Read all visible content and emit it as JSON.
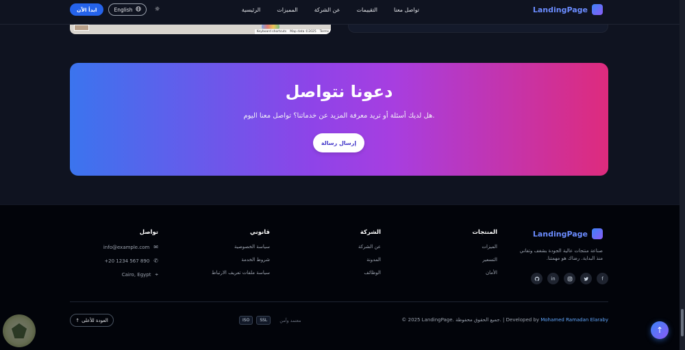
{
  "header": {
    "brand": "LandingPage",
    "nav": [
      "الرئيسية",
      "المميزات",
      "عن الشركة",
      "التقييمات",
      "تواصل معنا"
    ],
    "start_button": "ابدأ الآن",
    "language_button": "English"
  },
  "map": {
    "attribution": [
      "Keyboard shortcuts",
      "Map data ©2025",
      "Terms"
    ]
  },
  "cta": {
    "title": "دعونا نتواصل",
    "subtitle": "هل لديك أسئلة أو تريد معرفة المزيد عن خدماتنا؟ تواصل معنا اليوم.",
    "button": "إرسال رسالة"
  },
  "footer": {
    "brand": "LandingPage",
    "description": "صناعة منتجات عالية الجودة بشغف وتفاني منذ البداية. رضاك هو مهمتنا.",
    "columns": {
      "products": {
        "title": "المنتجات",
        "items": [
          "الميزات",
          "التسعير",
          "الأمان"
        ]
      },
      "company": {
        "title": "الشركة",
        "items": [
          "عن الشركة",
          "المدونة",
          "الوظائف"
        ]
      },
      "legal": {
        "title": "قانوني",
        "items": [
          "سياسة الخصوصية",
          "شروط الخدمة",
          "سياسة ملفات تعريف الارتباط"
        ]
      },
      "contact": {
        "title": "تواصل",
        "email": "info@example.com",
        "phone": "+20 1234 567 890",
        "location": "Cairo, Egypt"
      }
    },
    "copyright_prefix": "© 2025 LandingPage. جميع الحقوق محفوظة. | Developed by ",
    "developer": "Mohamed Ramadan Elaraby",
    "trust_label": "معتمد وآمن",
    "badges": [
      "ISO",
      "SSL"
    ],
    "back_to_top": "العودة للأعلى"
  },
  "colors": {
    "brand": "#6b8cff",
    "primary_button": "#2563eb",
    "cta_gradient": [
      "#3b74ee",
      "#8e44e8",
      "#de2b7d"
    ],
    "footer_bg": "#02040a",
    "page_bg": "#0f1320"
  }
}
